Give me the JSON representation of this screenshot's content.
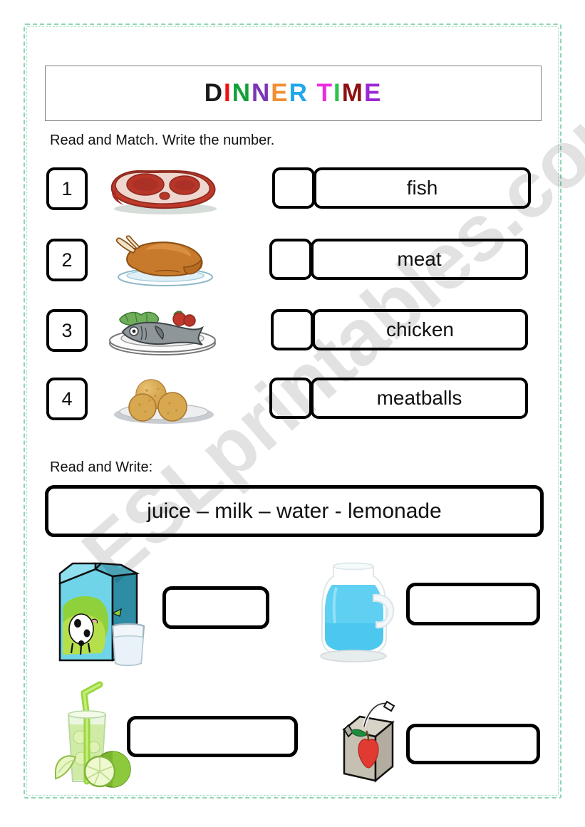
{
  "page": {
    "frame_color": "#8fd4b0",
    "watermark": "ESLprintables.com"
  },
  "title": {
    "text": "DINNER TIME",
    "letters": [
      {
        "ch": "D",
        "color": "#1a1a1a"
      },
      {
        "ch": "I",
        "color": "#ee1111"
      },
      {
        "ch": "N",
        "color": "#12a03a"
      },
      {
        "ch": "N",
        "color": "#7b35b5"
      },
      {
        "ch": "E",
        "color": "#ef9033"
      },
      {
        "ch": "R",
        "color": "#22a8e8"
      },
      {
        "ch": " ",
        "color": "#000000"
      },
      {
        "ch": "T",
        "color": "#ef2ae0"
      },
      {
        "ch": "I",
        "color": "#2fc24a"
      },
      {
        "ch": "M",
        "color": "#8e1111"
      },
      {
        "ch": "E",
        "color": "#9b27d6"
      }
    ]
  },
  "instructions": {
    "match": "Read and Match. Write the number.",
    "write": "Read and Write:"
  },
  "match": {
    "items": [
      {
        "number": "1",
        "picture": "steak-image",
        "picture_label": "steak"
      },
      {
        "number": "2",
        "picture": "roast-chicken-image",
        "picture_label": "roast chicken"
      },
      {
        "number": "3",
        "picture": "fish-plate-image",
        "picture_label": "fish on plate"
      },
      {
        "number": "4",
        "picture": "meatballs-image",
        "picture_label": "meatballs"
      }
    ],
    "words": [
      {
        "label": "fish",
        "answer": ""
      },
      {
        "label": "meat",
        "answer": ""
      },
      {
        "label": "chicken",
        "answer": ""
      },
      {
        "label": "meatballs",
        "answer": ""
      }
    ]
  },
  "wordbank": {
    "text": "juice – milk – water - lemonade"
  },
  "drinks": [
    {
      "picture": "milk-carton-image",
      "picture_label": "milk carton and glass",
      "answer": ""
    },
    {
      "picture": "water-pitcher-image",
      "picture_label": "water pitcher",
      "answer": ""
    },
    {
      "picture": "lemonade-glass-image",
      "picture_label": "lemonade glass with limes",
      "answer": ""
    },
    {
      "picture": "juice-box-image",
      "picture_label": "apple juice box",
      "answer": ""
    }
  ]
}
